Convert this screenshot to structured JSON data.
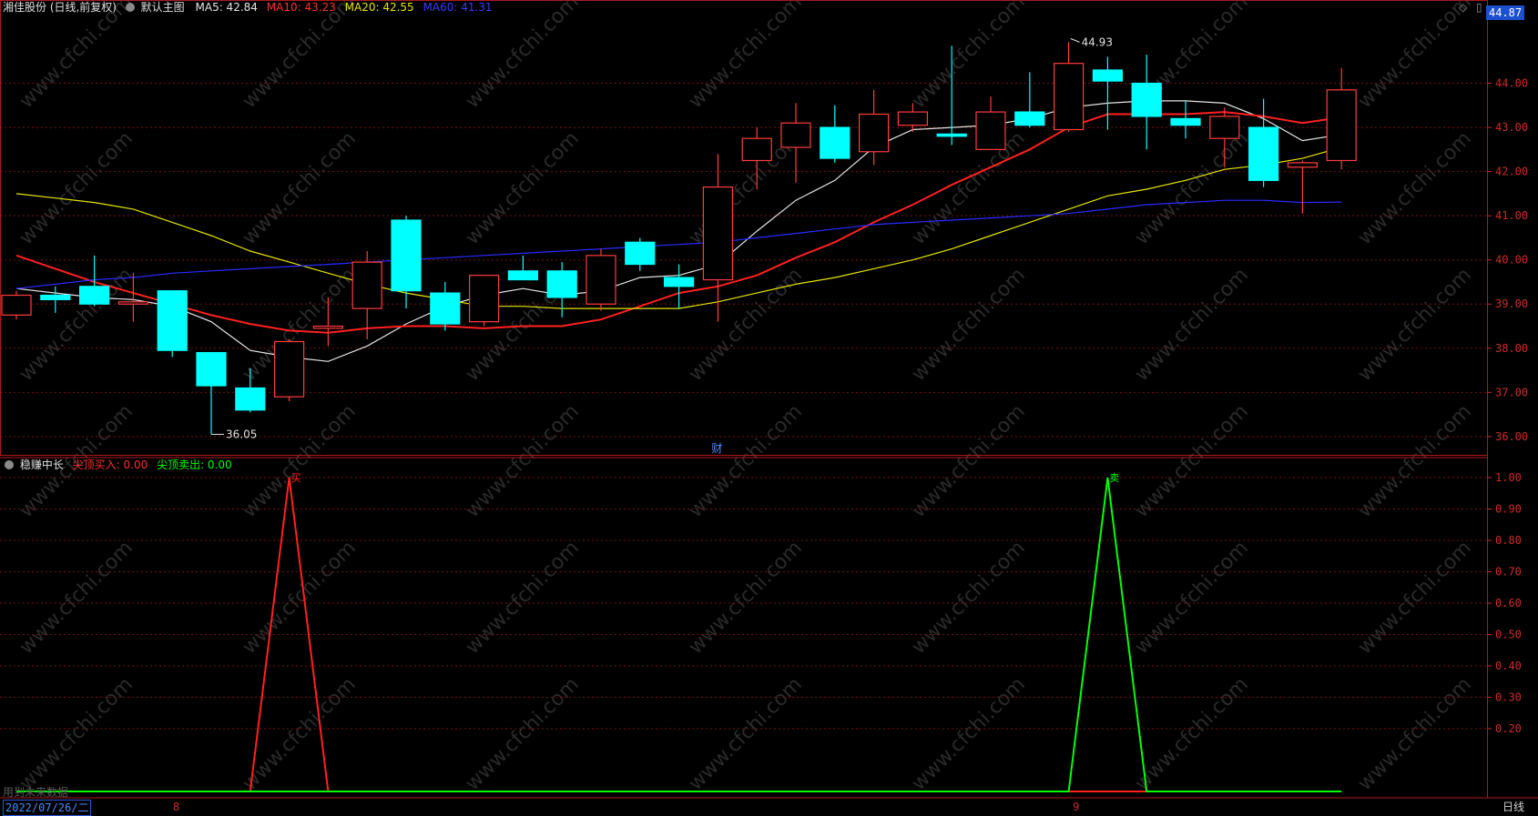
{
  "header": {
    "stock_title": "湘佳股份 (日线,前复权)",
    "main_chart_label": "默认主图",
    "ma5_label": "MA5: 42.84",
    "ma10_label": "MA10: 43.23",
    "ma20_label": "MA20: 42.55",
    "ma60_label": "MA60: 41.31",
    "current_price": "44.87",
    "diamond_icon": "diamond-icon",
    "panel_icon": "panel-toggle-icon"
  },
  "indicator": {
    "name": "稳赚中长",
    "buy_label": "尖顶买入: 0.00",
    "sell_label": "尖顶卖出: 0.00",
    "future_data_note": "用到未来数据"
  },
  "markers": {
    "high_label": "44.93",
    "low_label": "36.05",
    "finance_label": "财",
    "buy_signal_char": "买",
    "sell_signal_char": "卖"
  },
  "footer": {
    "date_label": "2022/07/26/二",
    "month1": "8",
    "month2": "9",
    "period_button": "日线"
  },
  "watermark": "www.cfchi.com",
  "colors": {
    "up": "#ff3c3c",
    "down": "#00ffff",
    "ma5": "#e6e6e6",
    "ma10": "#ff2020",
    "ma20": "#e6e600",
    "ma60": "#2a2aff",
    "grid": "#7a1010",
    "axis": "#cc2b2b",
    "buy_line": "#ff2020",
    "sell_line": "#00ff00"
  },
  "chart_data": [
    {
      "type": "candlestick",
      "price_axis_ticks": [
        "36.00",
        "37.00",
        "38.00",
        "39.00",
        "40.00",
        "41.00",
        "42.00",
        "43.00",
        "44.00"
      ],
      "ylim": [
        35.75,
        45.35
      ],
      "candles": [
        {
          "o": 38.75,
          "h": 39.3,
          "l": 38.65,
          "c": 39.2
        },
        {
          "o": 39.2,
          "h": 39.4,
          "l": 38.8,
          "c": 39.1
        },
        {
          "o": 39.4,
          "h": 40.1,
          "l": 38.95,
          "c": 39.0
        },
        {
          "o": 39.0,
          "h": 39.7,
          "l": 38.6,
          "c": 39.05
        },
        {
          "o": 39.3,
          "h": 39.3,
          "l": 37.8,
          "c": 37.95
        },
        {
          "o": 37.9,
          "h": 37.9,
          "l": 36.05,
          "c": 37.15
        },
        {
          "o": 37.1,
          "h": 37.55,
          "l": 36.55,
          "c": 36.6
        },
        {
          "o": 36.9,
          "h": 38.2,
          "l": 36.8,
          "c": 38.15
        },
        {
          "o": 38.45,
          "h": 39.15,
          "l": 38.05,
          "c": 38.5
        },
        {
          "o": 38.9,
          "h": 40.2,
          "l": 38.2,
          "c": 39.95
        },
        {
          "o": 40.9,
          "h": 41.0,
          "l": 38.9,
          "c": 39.3
        },
        {
          "o": 39.25,
          "h": 39.5,
          "l": 38.4,
          "c": 38.55
        },
        {
          "o": 38.6,
          "h": 39.65,
          "l": 38.5,
          "c": 39.65
        },
        {
          "o": 39.75,
          "h": 40.1,
          "l": 39.55,
          "c": 39.55
        },
        {
          "o": 39.75,
          "h": 39.95,
          "l": 38.7,
          "c": 39.15
        },
        {
          "o": 39.0,
          "h": 40.25,
          "l": 38.85,
          "c": 40.1
        },
        {
          "o": 40.4,
          "h": 40.5,
          "l": 39.75,
          "c": 39.9
        },
        {
          "o": 39.6,
          "h": 39.9,
          "l": 38.9,
          "c": 39.4
        },
        {
          "o": 39.55,
          "h": 42.4,
          "l": 38.6,
          "c": 41.65
        },
        {
          "o": 42.25,
          "h": 43.0,
          "l": 41.6,
          "c": 42.75
        },
        {
          "o": 42.55,
          "h": 43.55,
          "l": 41.75,
          "c": 43.1
        },
        {
          "o": 43.0,
          "h": 43.5,
          "l": 42.2,
          "c": 42.3
        },
        {
          "o": 42.45,
          "h": 43.85,
          "l": 42.15,
          "c": 43.3
        },
        {
          "o": 43.05,
          "h": 43.55,
          "l": 42.9,
          "c": 43.35
        },
        {
          "o": 42.85,
          "h": 44.85,
          "l": 42.6,
          "c": 42.8
        },
        {
          "o": 42.5,
          "h": 43.7,
          "l": 42.5,
          "c": 43.35
        },
        {
          "o": 43.35,
          "h": 44.25,
          "l": 43.0,
          "c": 43.05
        },
        {
          "o": 42.95,
          "h": 44.93,
          "l": 42.9,
          "c": 44.45
        },
        {
          "o": 44.3,
          "h": 44.6,
          "l": 42.95,
          "c": 44.05
        },
        {
          "o": 44.0,
          "h": 44.65,
          "l": 42.5,
          "c": 43.25
        },
        {
          "o": 43.2,
          "h": 43.6,
          "l": 42.75,
          "c": 43.05
        },
        {
          "o": 42.75,
          "h": 43.45,
          "l": 42.1,
          "c": 43.25
        },
        {
          "o": 43.0,
          "h": 43.65,
          "l": 41.65,
          "c": 41.8
        },
        {
          "o": 42.1,
          "h": 42.25,
          "l": 41.05,
          "c": 42.2
        },
        {
          "o": 42.25,
          "h": 44.35,
          "l": 42.05,
          "c": 43.85
        }
      ],
      "series": [
        {
          "name": "MA5",
          "key": "ma5",
          "values": [
            39.35,
            39.25,
            39.15,
            39.1,
            38.95,
            38.6,
            37.95,
            37.8,
            37.7,
            38.05,
            38.55,
            38.95,
            39.2,
            39.35,
            39.2,
            39.3,
            39.6,
            39.65,
            39.9,
            40.65,
            41.35,
            41.8,
            42.55,
            42.95,
            43.0,
            43.05,
            43.2,
            43.45,
            43.55,
            43.6,
            43.6,
            43.55,
            43.2,
            42.7,
            42.84
          ]
        },
        {
          "name": "MA10",
          "key": "ma10",
          "values": [
            40.1,
            39.8,
            39.5,
            39.25,
            39.0,
            38.75,
            38.55,
            38.4,
            38.35,
            38.45,
            38.5,
            38.5,
            38.45,
            38.5,
            38.5,
            38.65,
            38.95,
            39.25,
            39.4,
            39.65,
            40.05,
            40.4,
            40.85,
            41.25,
            41.7,
            42.1,
            42.5,
            43.0,
            43.3,
            43.3,
            43.3,
            43.35,
            43.25,
            43.1,
            43.23
          ]
        },
        {
          "name": "MA20",
          "key": "ma20",
          "values": [
            41.5,
            41.4,
            41.3,
            41.15,
            40.85,
            40.55,
            40.2,
            39.95,
            39.7,
            39.45,
            39.25,
            39.1,
            38.95,
            38.95,
            38.9,
            38.9,
            38.9,
            38.9,
            39.05,
            39.25,
            39.45,
            39.6,
            39.8,
            40.0,
            40.25,
            40.55,
            40.85,
            41.15,
            41.45,
            41.6,
            41.8,
            42.05,
            42.15,
            42.3,
            42.55
          ]
        },
        {
          "name": "MA60",
          "key": "ma60",
          "values": [
            39.35,
            39.45,
            39.55,
            39.6,
            39.7,
            39.75,
            39.8,
            39.85,
            39.9,
            39.95,
            40.0,
            40.05,
            40.1,
            40.15,
            40.2,
            40.25,
            40.3,
            40.35,
            40.4,
            40.5,
            40.6,
            40.7,
            40.8,
            40.85,
            40.9,
            40.95,
            41.0,
            41.05,
            41.15,
            41.25,
            41.3,
            41.35,
            41.35,
            41.3,
            41.31
          ]
        }
      ]
    },
    {
      "type": "line",
      "name": "稳赚中长",
      "y_axis_ticks": [
        "0.20",
        "0.30",
        "0.40",
        "0.50",
        "0.60",
        "0.70",
        "0.80",
        "0.90",
        "1.00"
      ],
      "ylim": [
        0,
        1.0
      ],
      "series": [
        {
          "name": "尖顶买入",
          "key": "buy",
          "values": [
            0,
            0,
            0,
            0,
            0,
            0,
            0,
            1,
            0,
            0,
            0,
            0,
            0,
            0,
            0,
            0,
            0,
            0,
            0,
            0,
            0,
            0,
            0,
            0,
            0,
            0,
            0,
            0,
            0,
            0,
            0,
            0,
            0,
            0,
            0
          ]
        },
        {
          "name": "尖顶卖出",
          "key": "sell",
          "values": [
            0,
            0,
            0,
            0,
            0,
            0,
            0,
            0,
            0,
            0,
            0,
            0,
            0,
            0,
            0,
            0,
            0,
            0,
            0,
            0,
            0,
            0,
            0,
            0,
            0,
            0,
            0,
            0,
            1,
            0,
            0,
            0,
            0,
            0,
            0
          ]
        }
      ]
    }
  ]
}
